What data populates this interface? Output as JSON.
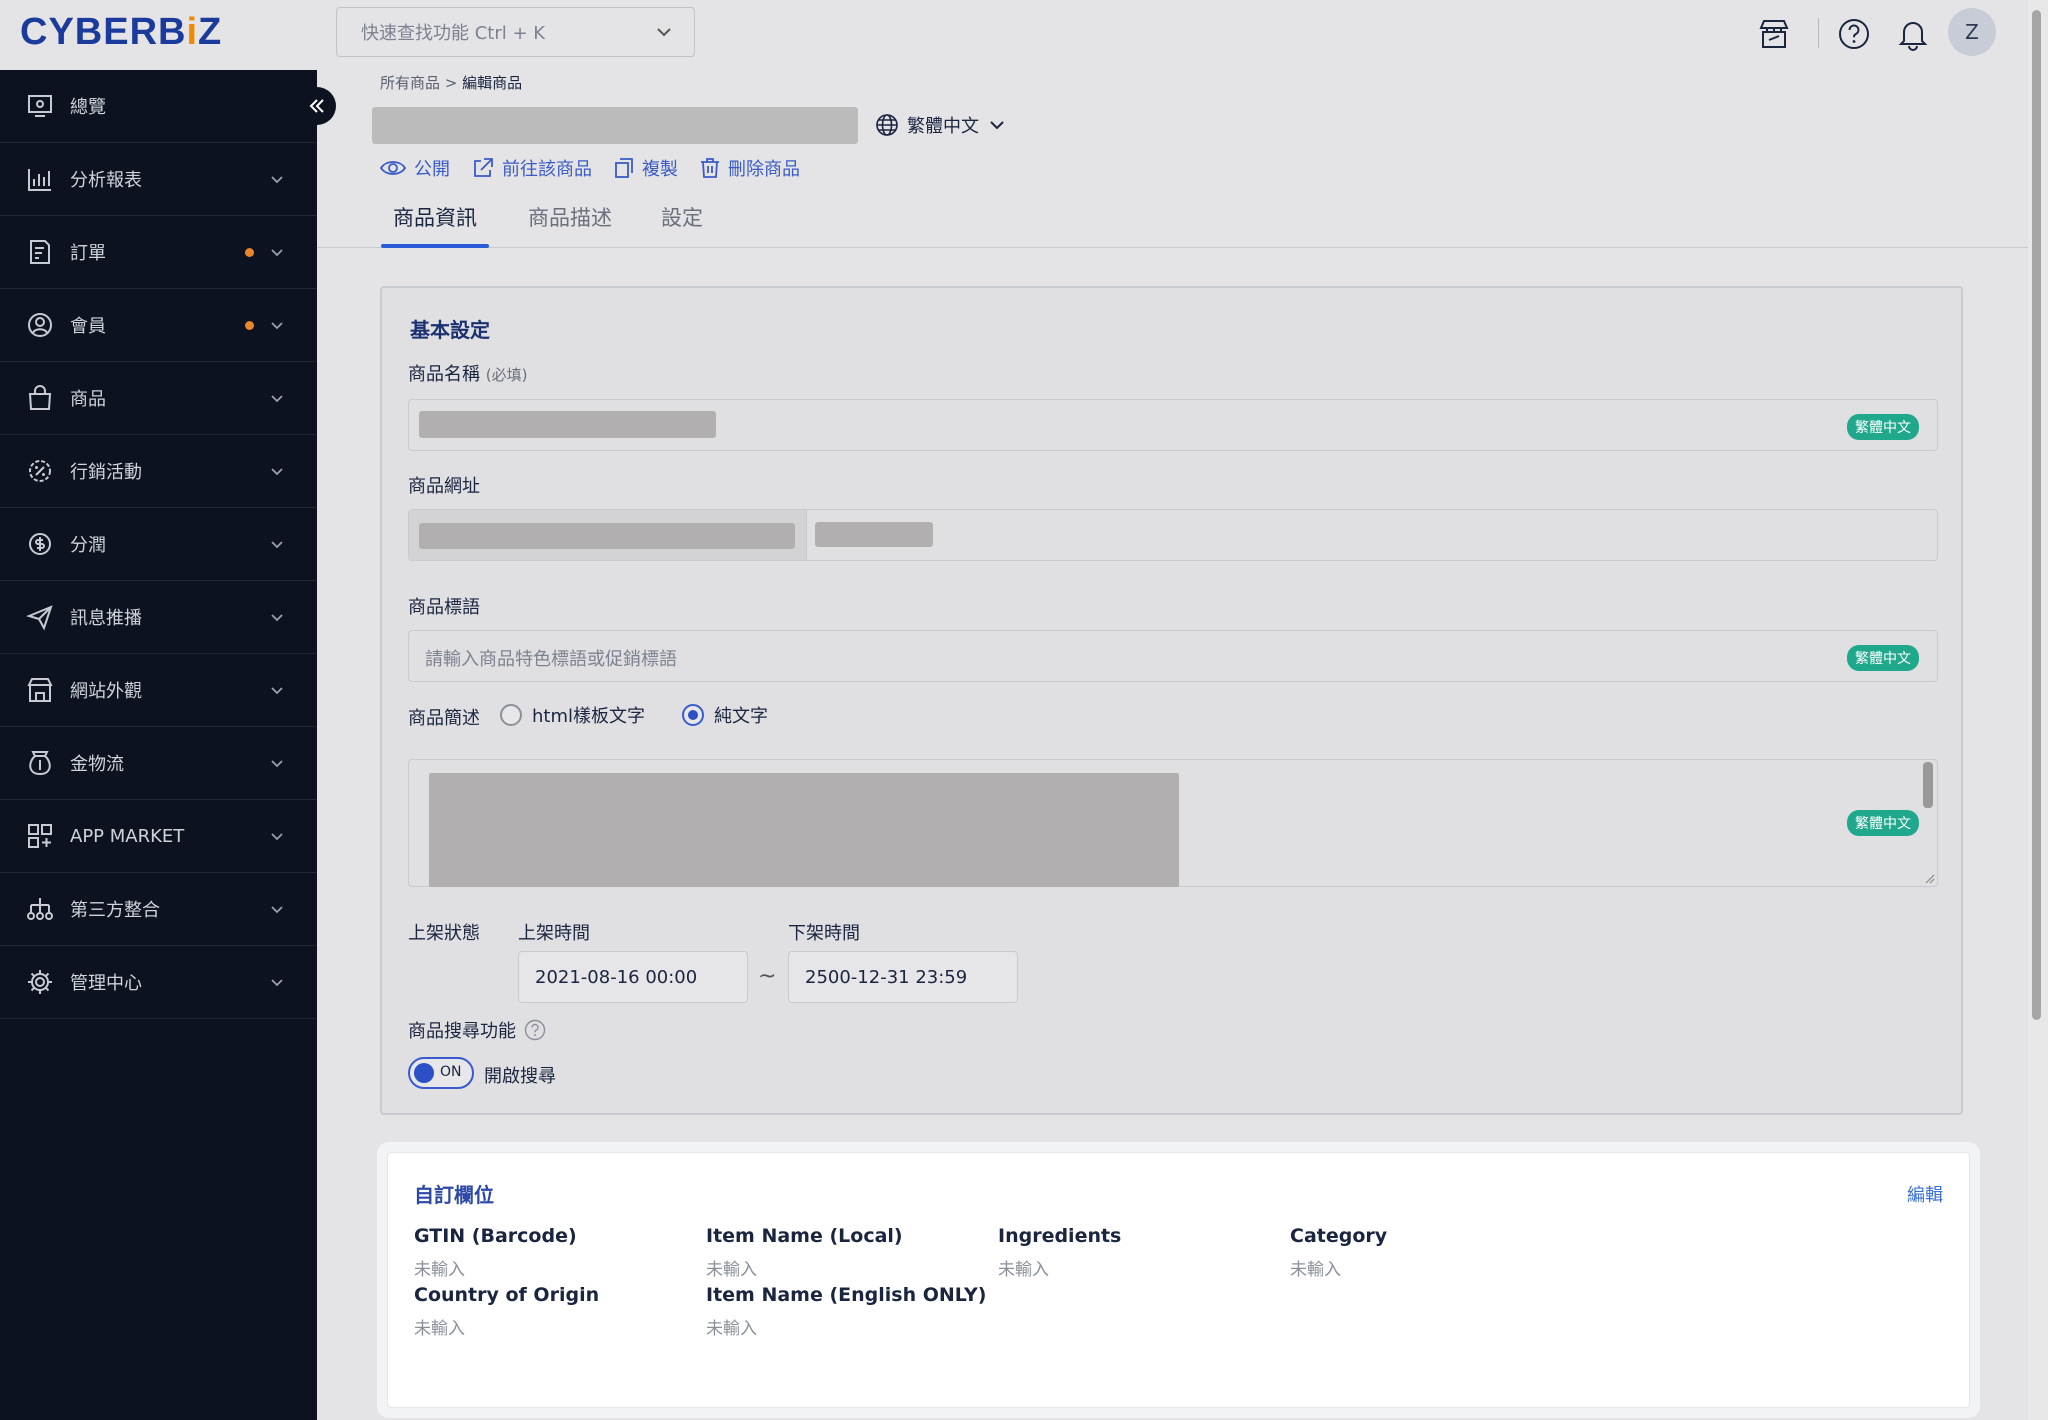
{
  "brand": {
    "logo_main": "CYBERB",
    "logo_dot": "i",
    "logo_end": "Z"
  },
  "topbar": {
    "quick_search": "快速查找功能 Ctrl + K",
    "avatar": "Z"
  },
  "sidebar": {
    "items": [
      {
        "label": "總覽",
        "icon": "dashboard-icon",
        "dot": false,
        "chevron": false
      },
      {
        "label": "分析報表",
        "icon": "bar-chart-icon",
        "dot": false,
        "chevron": true
      },
      {
        "label": "訂單",
        "icon": "order-icon",
        "dot": true,
        "chevron": true
      },
      {
        "label": "會員",
        "icon": "member-icon",
        "dot": true,
        "chevron": true
      },
      {
        "label": "商品",
        "icon": "bag-icon",
        "dot": false,
        "chevron": true
      },
      {
        "label": "行銷活動",
        "icon": "promo-icon",
        "dot": false,
        "chevron": true
      },
      {
        "label": "分潤",
        "icon": "profit-icon",
        "dot": false,
        "chevron": true
      },
      {
        "label": "訊息推播",
        "icon": "send-icon",
        "dot": false,
        "chevron": true
      },
      {
        "label": "網站外觀",
        "icon": "store-icon",
        "dot": false,
        "chevron": true
      },
      {
        "label": "金物流",
        "icon": "money-bag-icon",
        "dot": false,
        "chevron": true
      },
      {
        "label": "APP MARKET",
        "icon": "apps-icon",
        "dot": false,
        "chevron": true
      },
      {
        "label": "第三方整合",
        "icon": "integration-icon",
        "dot": false,
        "chevron": true
      },
      {
        "label": "管理中心",
        "icon": "gear-icon",
        "dot": false,
        "chevron": true
      }
    ]
  },
  "breadcrumb": {
    "parent": "所有商品",
    "sep": ">",
    "current": "編輯商品"
  },
  "language": "繁體中文",
  "actions": {
    "public": "公開",
    "goto": "前往該商品",
    "copy": "複製",
    "delete": "刪除商品"
  },
  "tabs": [
    "商品資訊",
    "商品描述",
    "設定"
  ],
  "basic": {
    "title": "基本設定",
    "name_label": "商品名稱",
    "name_required": "(必填)",
    "url_label": "商品網址",
    "slogan_label": "商品標語",
    "slogan_placeholder": "請輸入商品特色標語或促銷標語",
    "desc_label": "商品簡述",
    "desc_opt_html": "html樣板文字",
    "desc_opt_plain": "純文字",
    "lang_badge": "繁體中文",
    "shelf_label": "上架狀態",
    "start_label": "上架時間",
    "end_label": "下架時間",
    "start_value": "2021-08-16 00:00",
    "tilde": "~",
    "end_value": "2500-12-31 23:59",
    "search_label": "商品搜尋功能",
    "toggle_text": "ON",
    "toggle_desc": "開啟搜尋"
  },
  "custom_fields": {
    "title": "自訂欄位",
    "edit": "編輯",
    "fields": [
      {
        "key": "GTIN (Barcode)",
        "value": "未輸入"
      },
      {
        "key": "Item Name (Local)",
        "value": "未輸入"
      },
      {
        "key": "Ingredients",
        "value": "未輸入"
      },
      {
        "key": "Category",
        "value": "未輸入"
      },
      {
        "key": "Country of Origin",
        "value": "未輸入"
      },
      {
        "key": "Item Name (English ONLY)",
        "value": "未輸入"
      }
    ]
  },
  "colors": {
    "accent": "#2a5bd7",
    "badge": "#1fa88c",
    "sidebar_bg": "#0c1220",
    "dot": "#e8862a"
  }
}
